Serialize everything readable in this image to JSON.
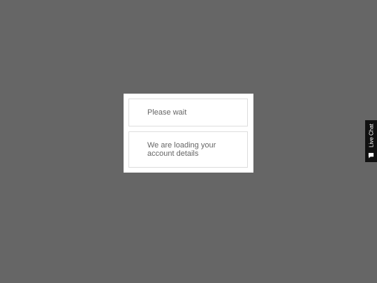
{
  "modal": {
    "title": "Please wait",
    "message": "We are loading your account details"
  },
  "live_chat": {
    "label": "Live Chat",
    "icon": "chat-bubble-icon"
  },
  "colors": {
    "overlay": "#666666",
    "modal_background": "#ffffff",
    "panel_border": "#dddddd",
    "text": "#666666",
    "live_chat_background": "#111111",
    "live_chat_text": "#ffffff"
  }
}
